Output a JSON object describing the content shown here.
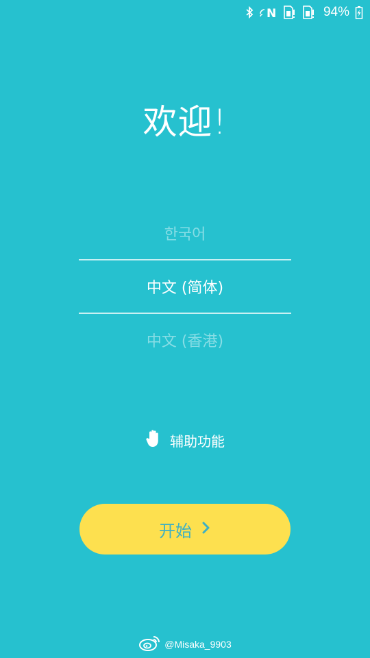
{
  "status_bar": {
    "battery_percent": "94%",
    "icons": [
      "bluetooth-icon",
      "nfc-icon",
      "sim1-icon",
      "sim2-icon",
      "battery-charging-icon"
    ]
  },
  "welcome": {
    "title": "欢迎!"
  },
  "languages": {
    "items": [
      {
        "label": "한국어",
        "state": "faded"
      },
      {
        "label": "中文 (简体)",
        "state": "selected"
      },
      {
        "label": "中文 (香港)",
        "state": "faded"
      }
    ]
  },
  "accessibility": {
    "icon": "hand-icon",
    "label": "辅助功能"
  },
  "start_button": {
    "label": "开始",
    "icon": "chevron-right-icon"
  },
  "watermark": {
    "text": "@Misaka_9903",
    "icon": "weibo-icon"
  },
  "colors": {
    "background": "#26c1cf",
    "button": "#fde04f",
    "button_text": "#3fb0c2"
  }
}
